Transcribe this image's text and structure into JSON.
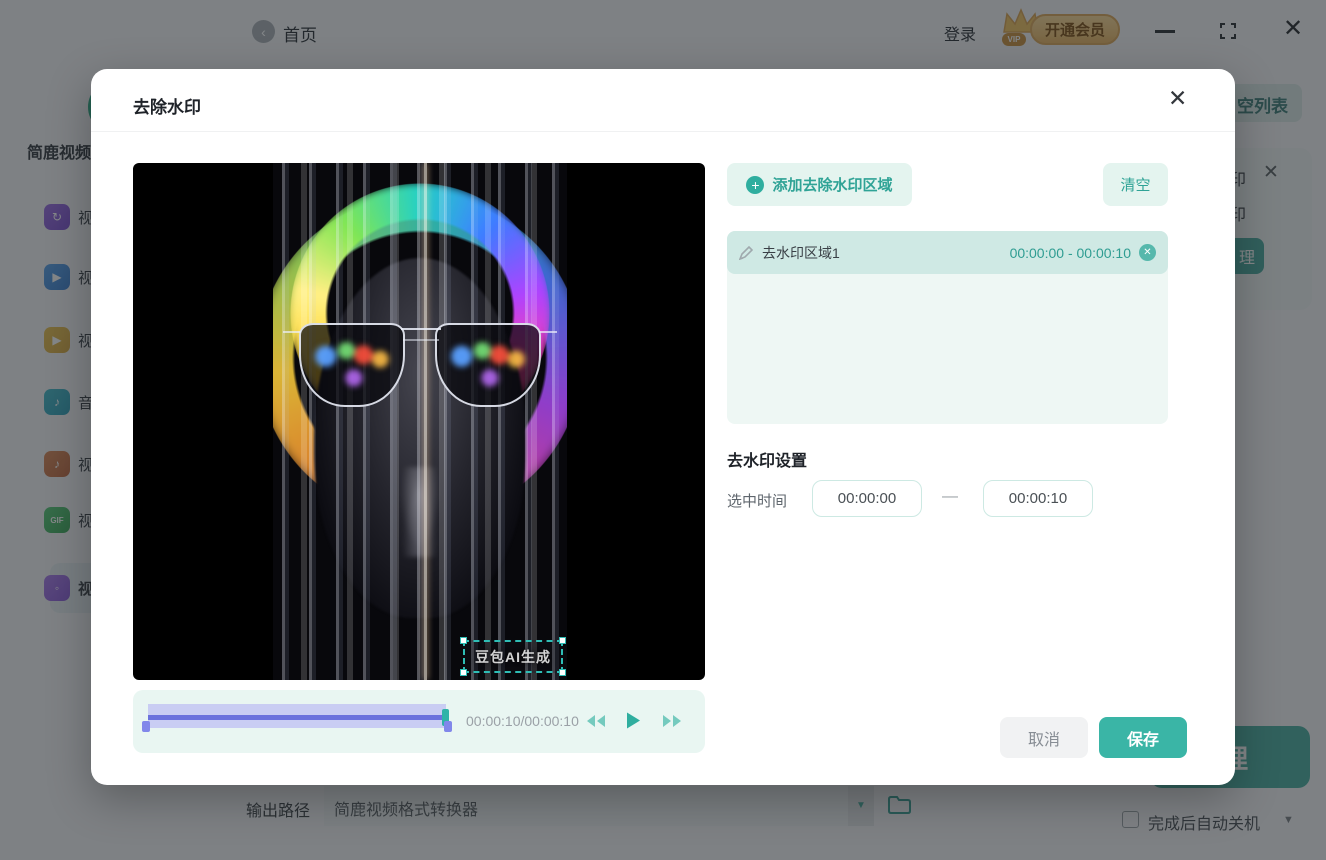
{
  "colors": {
    "accent": "#3ab5a6",
    "accent_light": "#e4f4ef",
    "row_selected": "#cfe9e4",
    "timeline_track": "#c9cdf3",
    "timeline_line": "#6b72dd",
    "vip_gold": "#e9b564",
    "selection_dash": "#2fbdb5"
  },
  "titlebar": {
    "home": "首页",
    "login": "登录",
    "vip_text": "开通会员",
    "vip_tag": "VIP"
  },
  "sidebar": {
    "brand": "简鹿视频",
    "items": [
      {
        "label": "视"
      },
      {
        "label": "视"
      },
      {
        "label": "视"
      },
      {
        "label": "音"
      },
      {
        "label": "视"
      },
      {
        "label": "视"
      },
      {
        "label": "视",
        "selected": true
      }
    ]
  },
  "background": {
    "clear_list_visible": "空列表",
    "card_line1": "印",
    "card_line2": "印",
    "process_small": "理",
    "process_large": "理",
    "output_path_label": "输出路径",
    "output_path_value": "简鹿视频格式转换器",
    "auto_shutdown": "完成后自动关机"
  },
  "modal": {
    "title": "去除水印",
    "add_area": "添加去除水印区域",
    "clear": "清空",
    "region": {
      "name": "去水印区域1",
      "range": "00:00:00 - 00:00:10"
    },
    "settings_title": "去水印设置",
    "selected_time_label": "选中时间",
    "time_start": "00:00:00",
    "time_end": "00:00:10",
    "dash": "—",
    "cancel": "取消",
    "save": "保存",
    "player_time": "00:00:10/00:00:10",
    "watermark": "豆包AI生成"
  }
}
